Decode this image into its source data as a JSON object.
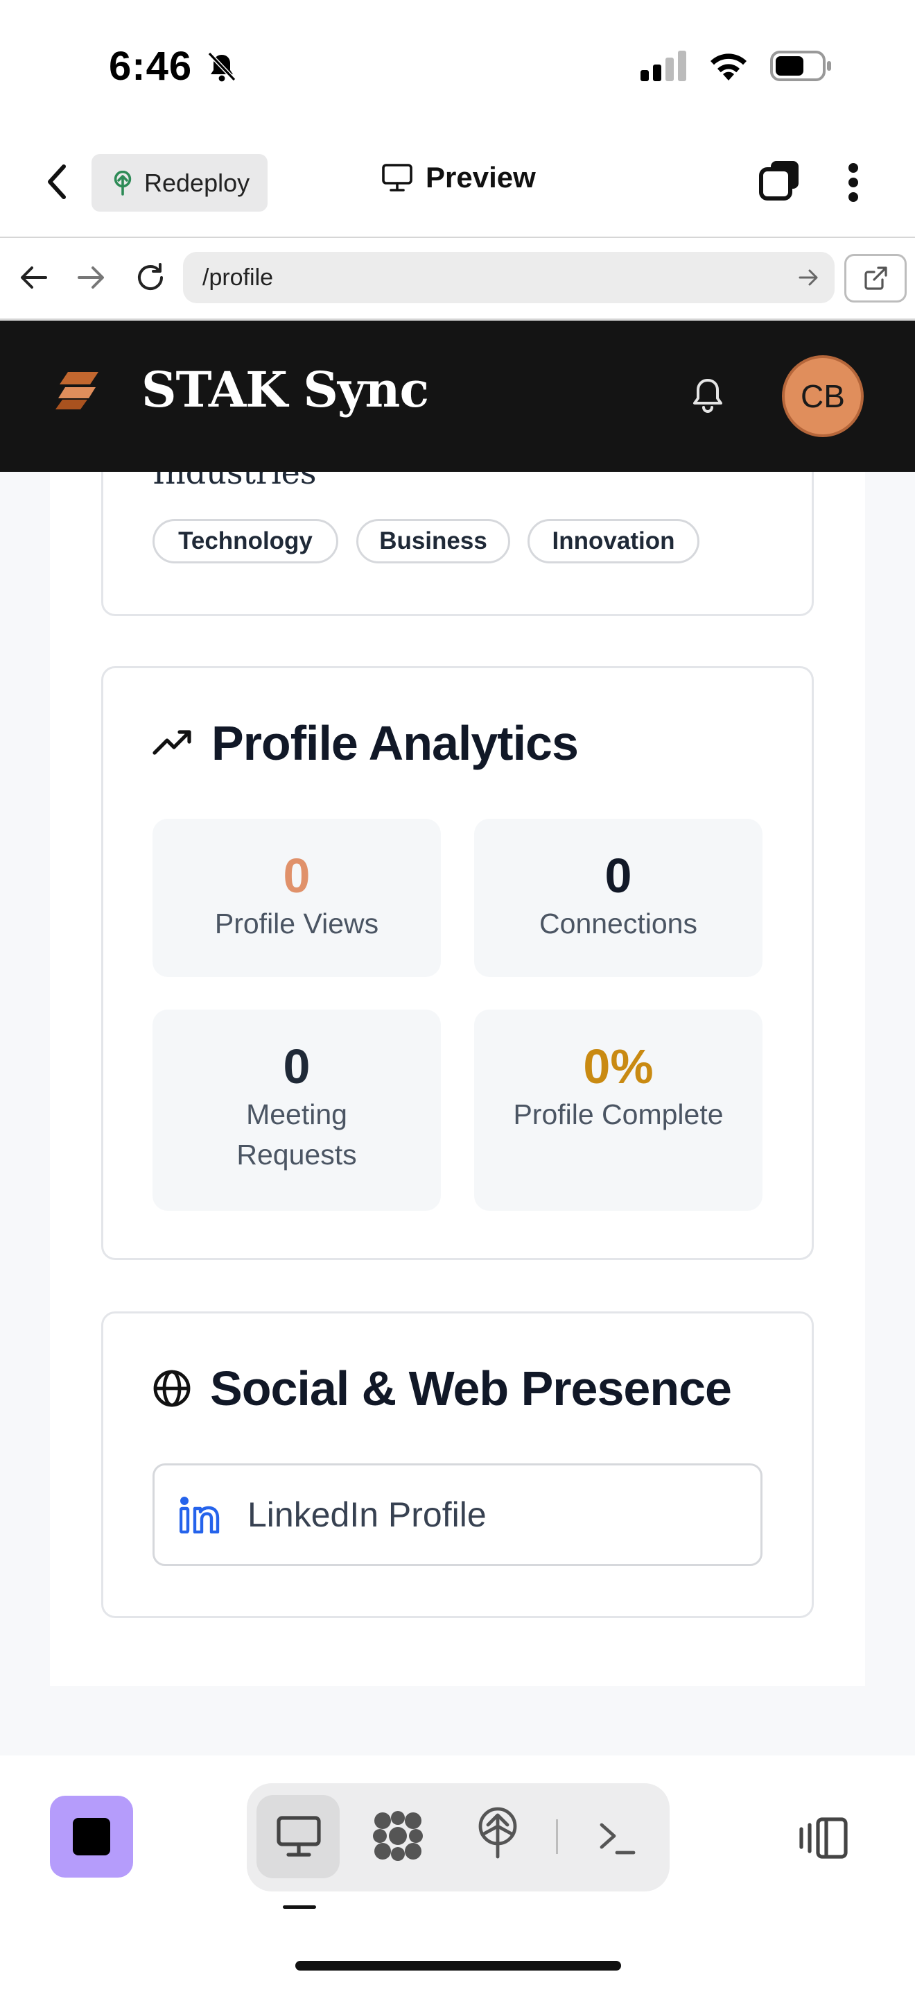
{
  "status_bar": {
    "time": "6:46"
  },
  "top_bar": {
    "redeploy_label": "Redeploy",
    "preview_label": "Preview"
  },
  "browser": {
    "url": "/profile"
  },
  "app": {
    "brand": "STAK Sync",
    "avatar_initials": "CB",
    "accent_color": "#e08e5c"
  },
  "industries": {
    "title": "Industries",
    "tags": [
      "Technology",
      "Business",
      "Innovation"
    ]
  },
  "analytics": {
    "title": "Profile Analytics",
    "stats": [
      {
        "value": "0",
        "label": "Profile Views",
        "color": "#e0916a"
      },
      {
        "value": "0",
        "label": "Connections",
        "color": "#111827"
      },
      {
        "value": "0",
        "label": "Meeting Requests",
        "color": "#1f2937"
      },
      {
        "value": "0%",
        "label": "Profile Complete",
        "color": "#c98a12"
      }
    ]
  },
  "social": {
    "title": "Social & Web Presence",
    "links": [
      {
        "label": "LinkedIn Profile",
        "icon": "linkedin-icon"
      }
    ]
  },
  "dock": {
    "items": [
      "stop-icon",
      "desktop-icon",
      "apps-icon",
      "deploy-icon",
      "terminal-icon",
      "panel-toggle-icon"
    ]
  }
}
